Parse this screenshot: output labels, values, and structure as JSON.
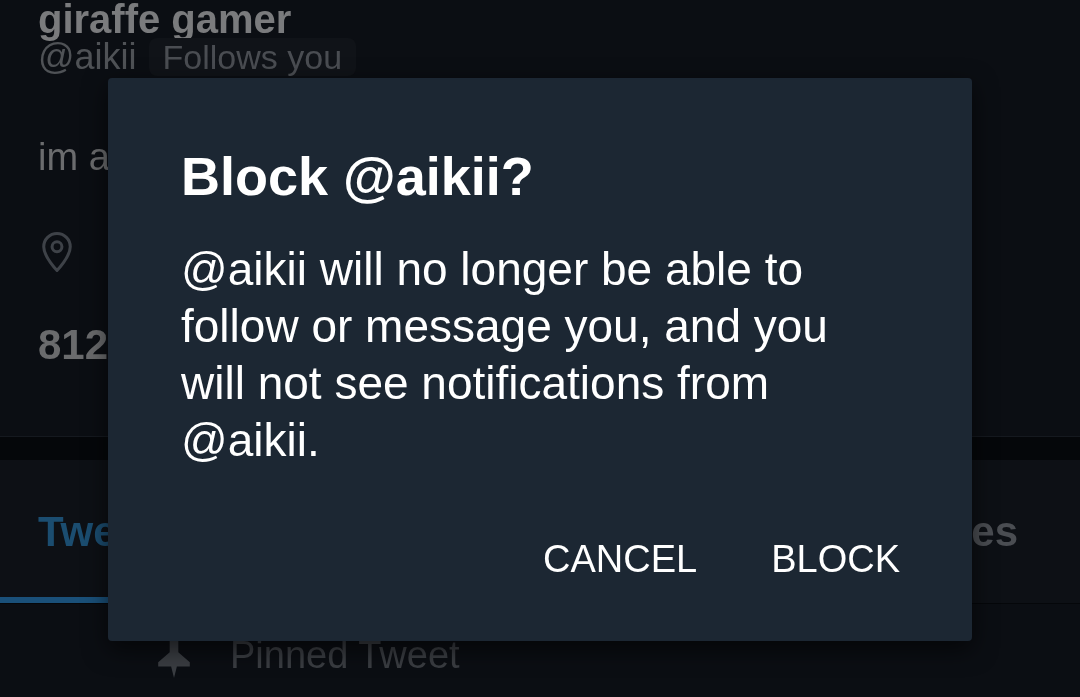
{
  "profile": {
    "name": "giraffe gamer",
    "handle": "@aikii",
    "follows_you_badge": "Follows you",
    "bio": "im a",
    "stats": "812"
  },
  "tabs": [
    {
      "label": "Twe",
      "selected": true
    },
    {
      "label": "es",
      "selected": false
    }
  ],
  "pinned": {
    "label": "Pinned Tweet"
  },
  "dialog": {
    "title": "Block @aikii?",
    "message": "@aikii will no longer be able to follow or message you, and you will not see notifications from @aikii.",
    "buttons": [
      {
        "label": "CANCEL"
      },
      {
        "label": "BLOCK"
      }
    ]
  }
}
